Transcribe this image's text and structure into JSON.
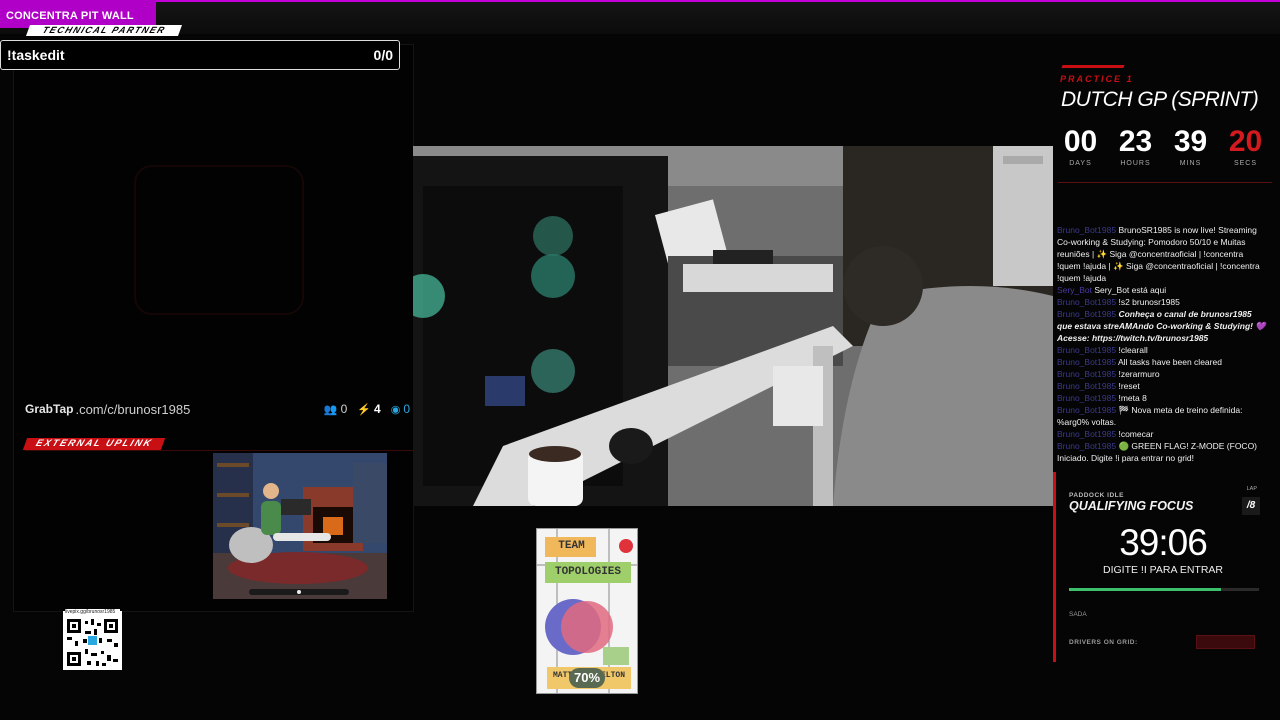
{
  "brand": {
    "title": "CONCENTRA PIT WALL",
    "subtitle": "TECHNICAL PARTNER"
  },
  "taskbox": {
    "command": "!taskedit",
    "count": "0/0"
  },
  "grabtap": {
    "logo": "GrabTap",
    "url": ".com/c/brunosr1985",
    "stats": [
      {
        "icon": "users-icon",
        "value": "0"
      },
      {
        "icon": "bolt-icon",
        "value": "4"
      },
      {
        "icon": "live-icon",
        "value": "0"
      }
    ]
  },
  "uplink": {
    "label": "EXTERNAL UPLINK"
  },
  "qr": {
    "label": "livepix.gg/brunosr1985"
  },
  "book": {
    "line1": "TEAM",
    "line2": "TOPOLOGIES",
    "author": "MATTHEW SKELTON",
    "progress": "70%"
  },
  "session": {
    "type": "PRACTICE 1",
    "race": "DUTCH GP (SPRINT)",
    "countdown": [
      {
        "value": "00",
        "label": "DAYS",
        "highlight": false
      },
      {
        "value": "23",
        "label": "HOURS",
        "highlight": false
      },
      {
        "value": "39",
        "label": "MINS",
        "highlight": false
      },
      {
        "value": "20",
        "label": "SECS",
        "highlight": true
      }
    ]
  },
  "chat": [
    {
      "user": "Bruno_Bot1985",
      "text": "BrunoSR1985 is now live! Streaming Co-working & Studying: Pomodoro 50/10 e Muitas reuniões | ✨ Siga @concentraoficial | !concentra !quem !ajuda | ✨ Siga @concentraoficial | !concentra !quem !ajuda",
      "style": "normal"
    },
    {
      "user": "Sery_Bot",
      "text": "Sery_Bot está aqui",
      "style": "normal"
    },
    {
      "user": "Bruno_Bot1985",
      "text": "!s2 brunosr1985",
      "style": "normal"
    },
    {
      "user": "Bruno_Bot1985",
      "text": "Conheça o canal de brunosr1985 que estava streAMAndo Co-working & Studying! 💜 Acesse: https://twitch.tv/brunosr1985",
      "style": "bold"
    },
    {
      "user": "Bruno_Bot1985",
      "text": "!clearall",
      "style": "normal"
    },
    {
      "user": "Bruno_Bot1985",
      "text": "All tasks have been cleared",
      "style": "normal"
    },
    {
      "user": "Bruno_Bot1985",
      "text": "!zerarmuro",
      "style": "normal"
    },
    {
      "user": "Bruno_Bot1985",
      "text": "!reset",
      "style": "normal"
    },
    {
      "user": "Bruno_Bot1985",
      "text": "!meta 8",
      "style": "normal"
    },
    {
      "user": "Bruno_Bot1985",
      "text": "🏁 Nova meta de treino definida: %arg0% voltas.",
      "style": "normal"
    },
    {
      "user": "Bruno_Bot1985",
      "text": "!comecar",
      "style": "normal"
    },
    {
      "user": "Bruno_Bot1985",
      "text": "🟢 GREEN FLAG! Z-MODE (FOCO) Iniciado. Digite !i para entrar no grid!",
      "style": "normal"
    }
  ],
  "qualifying": {
    "status": "PADDOCK IDLE",
    "title": "QUALIFYING FOCUS",
    "lap_label": "LAP",
    "lap": "/8",
    "time": "39:06",
    "instruction": "DIGITE !I PARA ENTRAR",
    "progress": 0.8,
    "sada_label": "SADA",
    "drivers_label": "DRIVERS ON GRID:"
  },
  "colors": {
    "accent_red": "#c80f14",
    "brand_magenta": "#b000c8",
    "progress_green": "#3dbf6b"
  }
}
